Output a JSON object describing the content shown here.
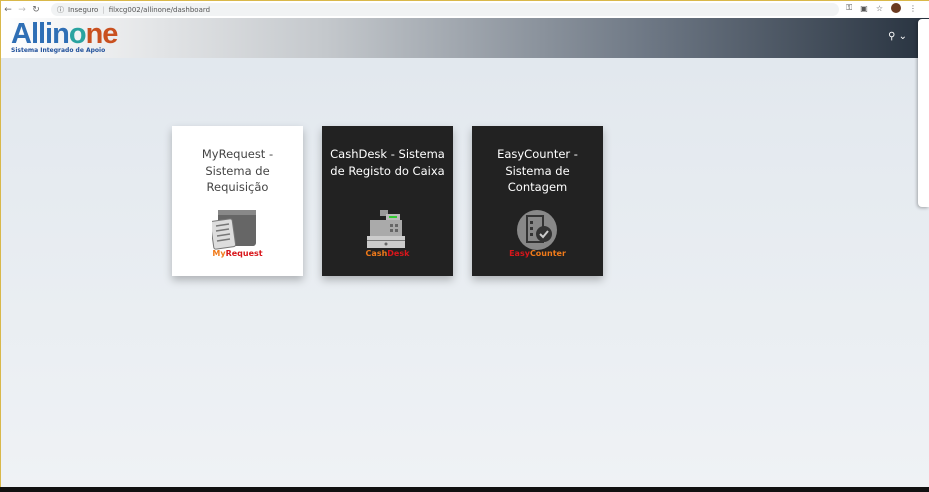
{
  "browser": {
    "security": "Inseguro",
    "url": "filxcg002/allinone/dashboard"
  },
  "header": {
    "logo": {
      "part1": "Allin",
      "part2": "o",
      "part3": "ne",
      "subtitle": "Sistema Integrado de Apoio"
    }
  },
  "cards": [
    {
      "title": "MyRequest - Sistema de Requisição",
      "logo_a": "My",
      "logo_b": "Request",
      "theme": "light"
    },
    {
      "title": "CashDesk - Sistema de Registo do Caixa",
      "logo_a": "Cash",
      "logo_b": "Desk",
      "theme": "dark"
    },
    {
      "title": "EasyCounter - Sistema de Contagem",
      "logo_a": "Easy",
      "logo_b": "Counter",
      "theme": "dark"
    }
  ],
  "colors": {
    "logo_orange": "#f07a1a",
    "logo_red": "#d8161b"
  }
}
